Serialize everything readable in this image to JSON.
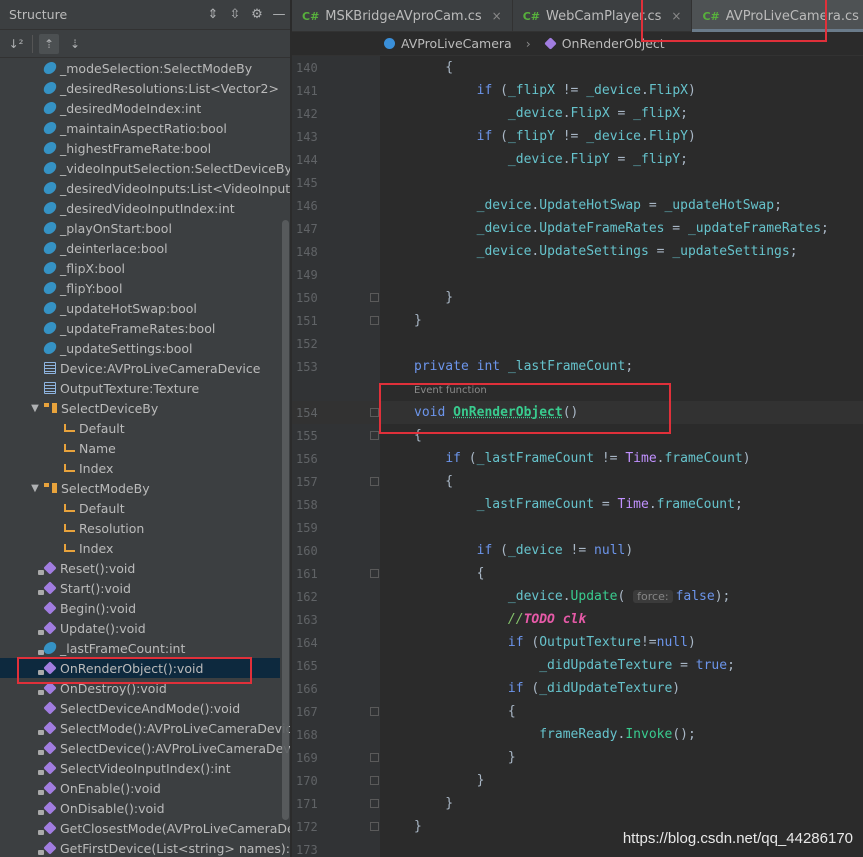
{
  "structure": {
    "title": "Structure",
    "items": [
      {
        "label": "_modeSelection:SelectModeBy",
        "icon": "field-icon",
        "level": 1
      },
      {
        "label": "_desiredResolutions:List<Vector2>",
        "icon": "field-icon",
        "level": 1
      },
      {
        "label": "_desiredModeIndex:int",
        "icon": "field-icon",
        "level": 1
      },
      {
        "label": "_maintainAspectRatio:bool",
        "icon": "field-icon",
        "level": 1
      },
      {
        "label": "_highestFrameRate:bool",
        "icon": "field-icon",
        "level": 1
      },
      {
        "label": "_videoInputSelection:SelectDeviceBy",
        "icon": "field-icon",
        "level": 1
      },
      {
        "label": "_desiredVideoInputs:List<VideoInput>",
        "icon": "field-icon",
        "level": 1
      },
      {
        "label": "_desiredVideoInputIndex:int",
        "icon": "field-icon",
        "level": 1
      },
      {
        "label": "_playOnStart:bool",
        "icon": "field-icon",
        "level": 1
      },
      {
        "label": "_deinterlace:bool",
        "icon": "field-icon",
        "level": 1
      },
      {
        "label": "_flipX:bool",
        "icon": "field-icon",
        "level": 1
      },
      {
        "label": "_flipY:bool",
        "icon": "field-icon",
        "level": 1
      },
      {
        "label": "_updateHotSwap:bool",
        "icon": "field-icon",
        "level": 1
      },
      {
        "label": "_updateFrameRates:bool",
        "icon": "field-icon",
        "level": 1
      },
      {
        "label": "_updateSettings:bool",
        "icon": "field-icon",
        "level": 1
      },
      {
        "label": "Device:AVProLiveCameraDevice",
        "icon": "property-icon",
        "level": 1
      },
      {
        "label": "OutputTexture:Texture",
        "icon": "property-icon",
        "level": 1
      },
      {
        "label": "SelectDeviceBy",
        "icon": "enum-icon",
        "level": 0,
        "expanded": true
      },
      {
        "label": "Default",
        "icon": "enum-member-icon",
        "level": 2
      },
      {
        "label": "Name",
        "icon": "enum-member-icon",
        "level": 2
      },
      {
        "label": "Index",
        "icon": "enum-member-icon",
        "level": 2
      },
      {
        "label": "SelectModeBy",
        "icon": "enum-icon",
        "level": 0,
        "expanded": true
      },
      {
        "label": "Default",
        "icon": "enum-member-icon",
        "level": 2
      },
      {
        "label": "Resolution",
        "icon": "enum-member-icon",
        "level": 2
      },
      {
        "label": "Index",
        "icon": "enum-member-icon",
        "level": 2
      },
      {
        "label": "Reset():void",
        "icon": "method-icon",
        "level": 1,
        "locked": true
      },
      {
        "label": "Start():void",
        "icon": "method-icon",
        "level": 1,
        "locked": true
      },
      {
        "label": "Begin():void",
        "icon": "method-icon",
        "level": 1
      },
      {
        "label": "Update():void",
        "icon": "method-icon",
        "level": 1,
        "locked": true
      },
      {
        "label": "_lastFrameCount:int",
        "icon": "field-icon",
        "level": 1,
        "locked": true
      },
      {
        "label": "OnRenderObject():void",
        "icon": "method-icon",
        "level": 1,
        "locked": true,
        "selected": true
      },
      {
        "label": "OnDestroy():void",
        "icon": "method-icon",
        "level": 1,
        "locked": true
      },
      {
        "label": "SelectDeviceAndMode():void",
        "icon": "method-icon",
        "level": 1
      },
      {
        "label": "SelectMode():AVProLiveCameraDeviceMode",
        "icon": "method-icon",
        "level": 1,
        "locked": true
      },
      {
        "label": "SelectDevice():AVProLiveCameraDevice",
        "icon": "method-icon",
        "level": 1,
        "locked": true
      },
      {
        "label": "SelectVideoInputIndex():int",
        "icon": "method-icon",
        "level": 1,
        "locked": true
      },
      {
        "label": "OnEnable():void",
        "icon": "method-icon",
        "level": 1,
        "locked": true
      },
      {
        "label": "OnDisable():void",
        "icon": "method-icon",
        "level": 1,
        "locked": true
      },
      {
        "label": "GetClosestMode(AVProLiveCameraDevice...",
        "icon": "method-icon",
        "level": 1,
        "locked": true
      },
      {
        "label": "GetFirstDevice(List<string> names):AVPro...",
        "icon": "method-icon",
        "level": 1,
        "locked": true
      }
    ]
  },
  "tabs": [
    {
      "lang": "C#",
      "label": "MSKBridgeAVproCam.cs",
      "active": false
    },
    {
      "lang": "C#",
      "label": "WebCamPlayer.cs",
      "active": false
    },
    {
      "lang": "C#",
      "label": "AVProLiveCamera.cs",
      "active": true
    }
  ],
  "breadcrumb": {
    "class_name": "AVProLiveCamera",
    "method_name": "OnRenderObject"
  },
  "editor": {
    "event_hint": "Event function",
    "param_hint": "force:",
    "lines": [
      {
        "n": "140"
      },
      {
        "n": "141"
      },
      {
        "n": "142"
      },
      {
        "n": "143"
      },
      {
        "n": "144"
      },
      {
        "n": "145"
      },
      {
        "n": "146"
      },
      {
        "n": "147"
      },
      {
        "n": "148"
      },
      {
        "n": "149"
      },
      {
        "n": "150"
      },
      {
        "n": "151"
      },
      {
        "n": "152"
      },
      {
        "n": "153"
      },
      {
        "n": "154"
      },
      {
        "n": "155"
      },
      {
        "n": "156"
      },
      {
        "n": "157"
      },
      {
        "n": "158"
      },
      {
        "n": "159"
      },
      {
        "n": "160"
      },
      {
        "n": "161"
      },
      {
        "n": "162"
      },
      {
        "n": "163"
      },
      {
        "n": "164"
      },
      {
        "n": "165"
      },
      {
        "n": "166"
      },
      {
        "n": "167"
      },
      {
        "n": "168"
      },
      {
        "n": "169"
      },
      {
        "n": "170"
      },
      {
        "n": "171"
      },
      {
        "n": "172"
      },
      {
        "n": "173"
      }
    ]
  },
  "watermark": "https://blog.csdn.net/qq_44286170"
}
